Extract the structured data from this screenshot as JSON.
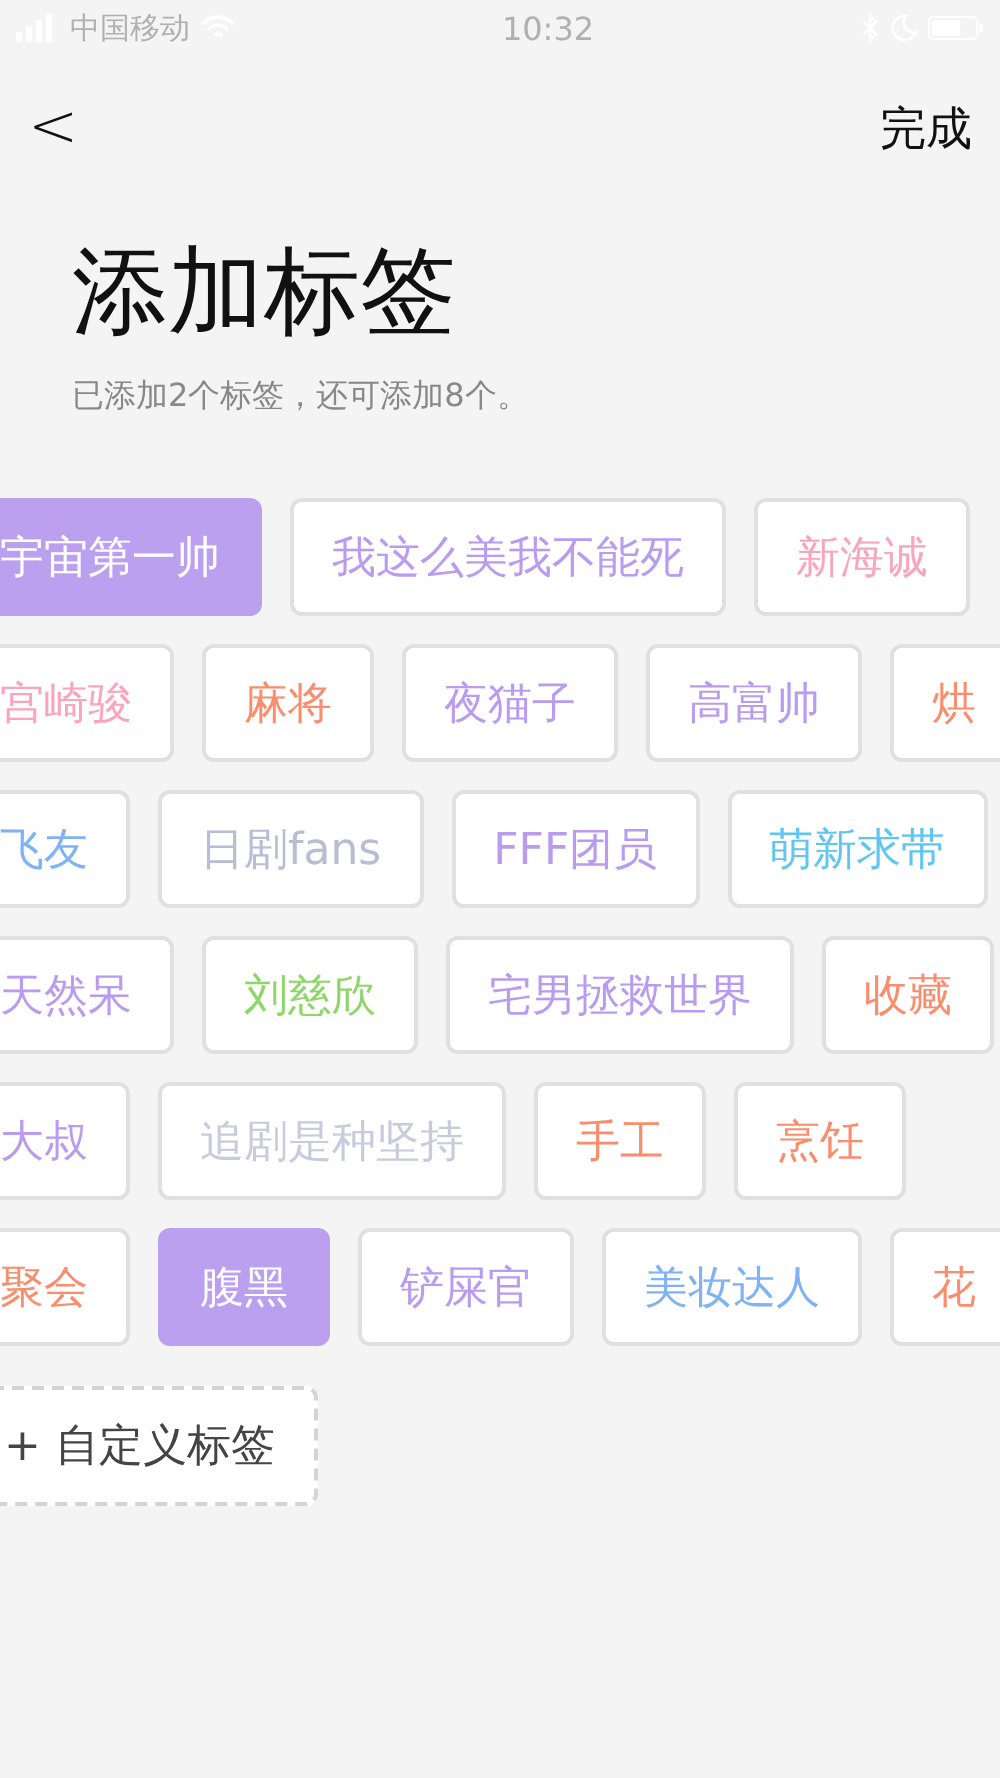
{
  "status_bar": {
    "carrier": "中国移动",
    "time": "10:32"
  },
  "nav": {
    "back": "<",
    "done": "完成"
  },
  "title": "添加标签",
  "subtitle": "已添加2个标签，还可添加8个。",
  "tag_rows": [
    [
      {
        "label": "宇宙第一帅",
        "color": "#bba0f0",
        "selected": true
      },
      {
        "label": "我这么美我不能死",
        "color": "#b99cf0",
        "selected": false
      },
      {
        "label": "新海诚",
        "color": "#f9a5bd",
        "selected": false
      }
    ],
    [
      {
        "label": "宫崎骏",
        "color": "#f9a5bd",
        "selected": false
      },
      {
        "label": "麻将",
        "color": "#f98e6e",
        "selected": false
      },
      {
        "label": "夜猫子",
        "color": "#b99cf0",
        "selected": false
      },
      {
        "label": "高富帅",
        "color": "#b99cf0",
        "selected": false
      },
      {
        "label": "烘",
        "color": "#f98e6e",
        "selected": false
      }
    ],
    [
      {
        "label": "飞友",
        "color": "#7fb3f5",
        "selected": false
      },
      {
        "label": "日剧fans",
        "color": "#b8bcd4",
        "selected": false
      },
      {
        "label": "FFF团员",
        "color": "#b99cf0",
        "selected": false
      },
      {
        "label": "萌新求带",
        "color": "#5fc6f2",
        "selected": false
      }
    ],
    [
      {
        "label": "天然呆",
        "color": "#b99cf0",
        "selected": false
      },
      {
        "label": "刘慈欣",
        "color": "#8ed66a",
        "selected": false
      },
      {
        "label": "宅男拯救世界",
        "color": "#b99cf0",
        "selected": false
      },
      {
        "label": "收藏",
        "color": "#f98e6e",
        "selected": false
      }
    ],
    [
      {
        "label": "大叔",
        "color": "#b99cf0",
        "selected": false
      },
      {
        "label": "追剧是种坚持",
        "color": "#c8cbdc",
        "selected": false
      },
      {
        "label": "手工",
        "color": "#f98e6e",
        "selected": false
      },
      {
        "label": "烹饪",
        "color": "#f98e6e",
        "selected": false
      }
    ],
    [
      {
        "label": "聚会",
        "color": "#f98e6e",
        "selected": false
      },
      {
        "label": "腹黑",
        "color": "#bba0f0",
        "selected": true
      },
      {
        "label": "铲屎官",
        "color": "#b99cf0",
        "selected": false
      },
      {
        "label": "美妆达人",
        "color": "#7fb3f5",
        "selected": false
      },
      {
        "label": "花",
        "color": "#f98e6e",
        "selected": false
      }
    ]
  ],
  "custom_tag": {
    "plus": "+",
    "label": "自定义标签"
  }
}
